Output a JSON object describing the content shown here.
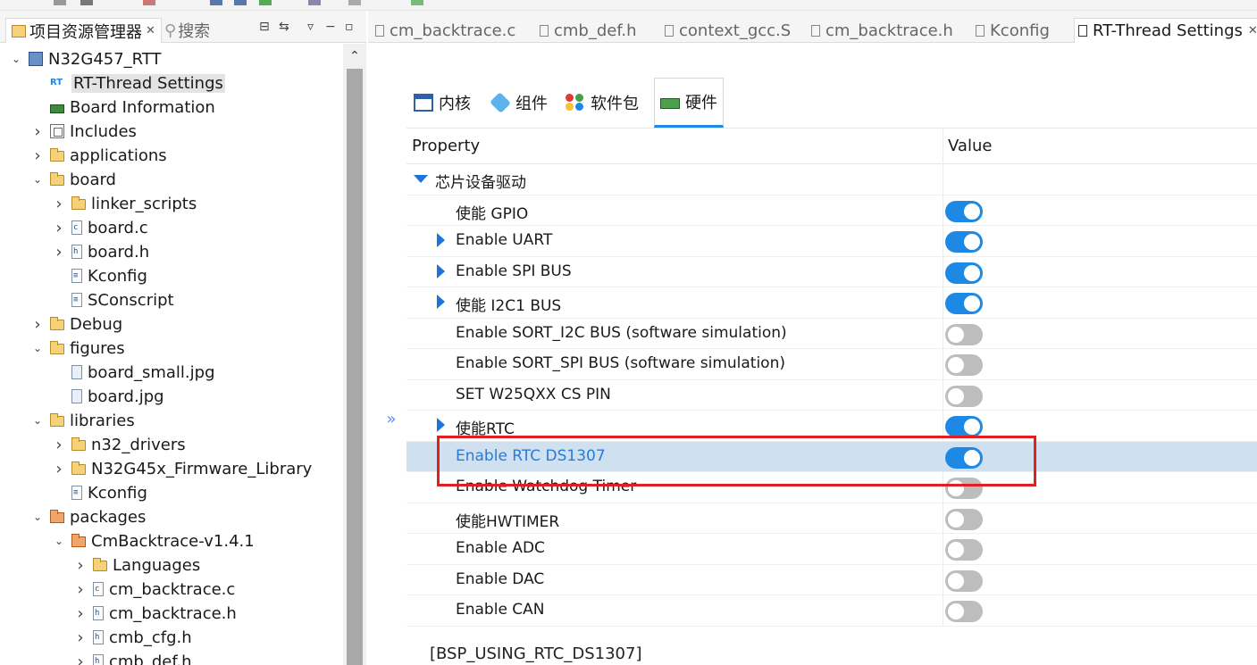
{
  "colors": {
    "accent": "#1e88e5",
    "toggle_off": "#bdbdbd",
    "selected_row": "#cfe0f1",
    "annotation": "#e02020"
  },
  "left_panel": {
    "tabs": [
      {
        "label": "项目资源管理器",
        "icon": "folder-tree-icon"
      },
      {
        "label": "搜索",
        "icon": "search-icon"
      }
    ],
    "tree": [
      {
        "label": "N32G457_RTT",
        "icon": "project",
        "level": 0,
        "expanded": true
      },
      {
        "label": "RT-Thread Settings",
        "icon": "rt",
        "level": 1,
        "selected": true
      },
      {
        "label": "Board Information",
        "icon": "board",
        "level": 1
      },
      {
        "label": "Includes",
        "icon": "include",
        "level": 1,
        "collapsed": true
      },
      {
        "label": "applications",
        "icon": "folder",
        "level": 1,
        "collapsed": true
      },
      {
        "label": "board",
        "icon": "folder",
        "level": 1,
        "expanded": true
      },
      {
        "label": "linker_scripts",
        "icon": "folder",
        "level": 2,
        "collapsed": true
      },
      {
        "label": "board.c",
        "icon": "c-file",
        "level": 2,
        "collapsed": true
      },
      {
        "label": "board.h",
        "icon": "h-file",
        "level": 2,
        "collapsed": true
      },
      {
        "label": "Kconfig",
        "icon": "text-file",
        "level": 2
      },
      {
        "label": "SConscript",
        "icon": "text-file",
        "level": 2
      },
      {
        "label": "Debug",
        "icon": "folder",
        "level": 1,
        "collapsed": true
      },
      {
        "label": "figures",
        "icon": "folder",
        "level": 1,
        "expanded": true
      },
      {
        "label": "board_small.jpg",
        "icon": "image-file",
        "level": 2
      },
      {
        "label": "board.jpg",
        "icon": "image-file",
        "level": 2
      },
      {
        "label": "libraries",
        "icon": "folder",
        "level": 1,
        "expanded": true
      },
      {
        "label": "n32_drivers",
        "icon": "folder",
        "level": 2,
        "collapsed": true
      },
      {
        "label": "N32G45x_Firmware_Library",
        "icon": "folder",
        "level": 2,
        "collapsed": true
      },
      {
        "label": "Kconfig",
        "icon": "text-file",
        "level": 2
      },
      {
        "label": "packages",
        "icon": "package-folder",
        "level": 1,
        "expanded": true
      },
      {
        "label": "CmBacktrace-v1.4.1",
        "icon": "package-folder",
        "level": 2,
        "expanded": true
      },
      {
        "label": "Languages",
        "icon": "folder",
        "level": 3,
        "collapsed": true
      },
      {
        "label": "cm_backtrace.c",
        "icon": "c-file",
        "level": 3,
        "collapsed": true
      },
      {
        "label": "cm_backtrace.h",
        "icon": "h-file",
        "level": 3,
        "collapsed": true
      },
      {
        "label": "cmb_cfg.h",
        "icon": "h-file",
        "level": 3,
        "collapsed": true
      },
      {
        "label": "cmb_def.h",
        "icon": "h-file",
        "level": 3,
        "collapsed": true
      }
    ]
  },
  "editor_tabs": [
    {
      "label": "cm_backtrace.c",
      "icon": "c-file-icon"
    },
    {
      "label": "cmb_def.h",
      "icon": "h-file-icon"
    },
    {
      "label": "context_gcc.S",
      "icon": "s-file-icon"
    },
    {
      "label": "cm_backtrace.h",
      "icon": "h-file-icon"
    },
    {
      "label": "Kconfig",
      "icon": "text-file-icon"
    },
    {
      "label": "RT-Thread Settings",
      "icon": "settings-file-icon",
      "active": true
    }
  ],
  "settings": {
    "tabs": [
      {
        "label": "内核",
        "icon": "kernel-icon"
      },
      {
        "label": "组件",
        "icon": "component-icon"
      },
      {
        "label": "软件包",
        "icon": "package-icon"
      },
      {
        "label": "硬件",
        "icon": "hardware-icon",
        "active": true
      }
    ],
    "columns": {
      "property": "Property",
      "value": "Value"
    },
    "group": {
      "label": "芯片设备驱动",
      "expanded": true
    },
    "rows": [
      {
        "label": "使能 GPIO",
        "on": true,
        "expandable": false
      },
      {
        "label": "Enable UART",
        "on": true,
        "expandable": true
      },
      {
        "label": "Enable SPI BUS",
        "on": true,
        "expandable": true
      },
      {
        "label": "使能 I2C1 BUS",
        "on": true,
        "expandable": true
      },
      {
        "label": "Enable SORT_I2C BUS (software simulation)",
        "on": false,
        "expandable": false
      },
      {
        "label": "Enable SORT_SPI BUS (software simulation)",
        "on": false,
        "expandable": false
      },
      {
        "label": "SET W25QXX CS PIN",
        "on": false,
        "expandable": false
      },
      {
        "label": "使能RTC",
        "on": true,
        "expandable": true
      },
      {
        "label": "Enable RTC DS1307",
        "on": true,
        "expandable": false,
        "highlighted": true
      },
      {
        "label": "Enable Watchdog Timer",
        "on": false,
        "expandable": false
      },
      {
        "label": "使能HWTIMER",
        "on": false,
        "expandable": false
      },
      {
        "label": "Enable ADC",
        "on": false,
        "expandable": false
      },
      {
        "label": "Enable DAC",
        "on": false,
        "expandable": false
      },
      {
        "label": "Enable CAN",
        "on": false,
        "expandable": false
      }
    ],
    "symbol": "[BSP_USING_RTC_DS1307]"
  }
}
